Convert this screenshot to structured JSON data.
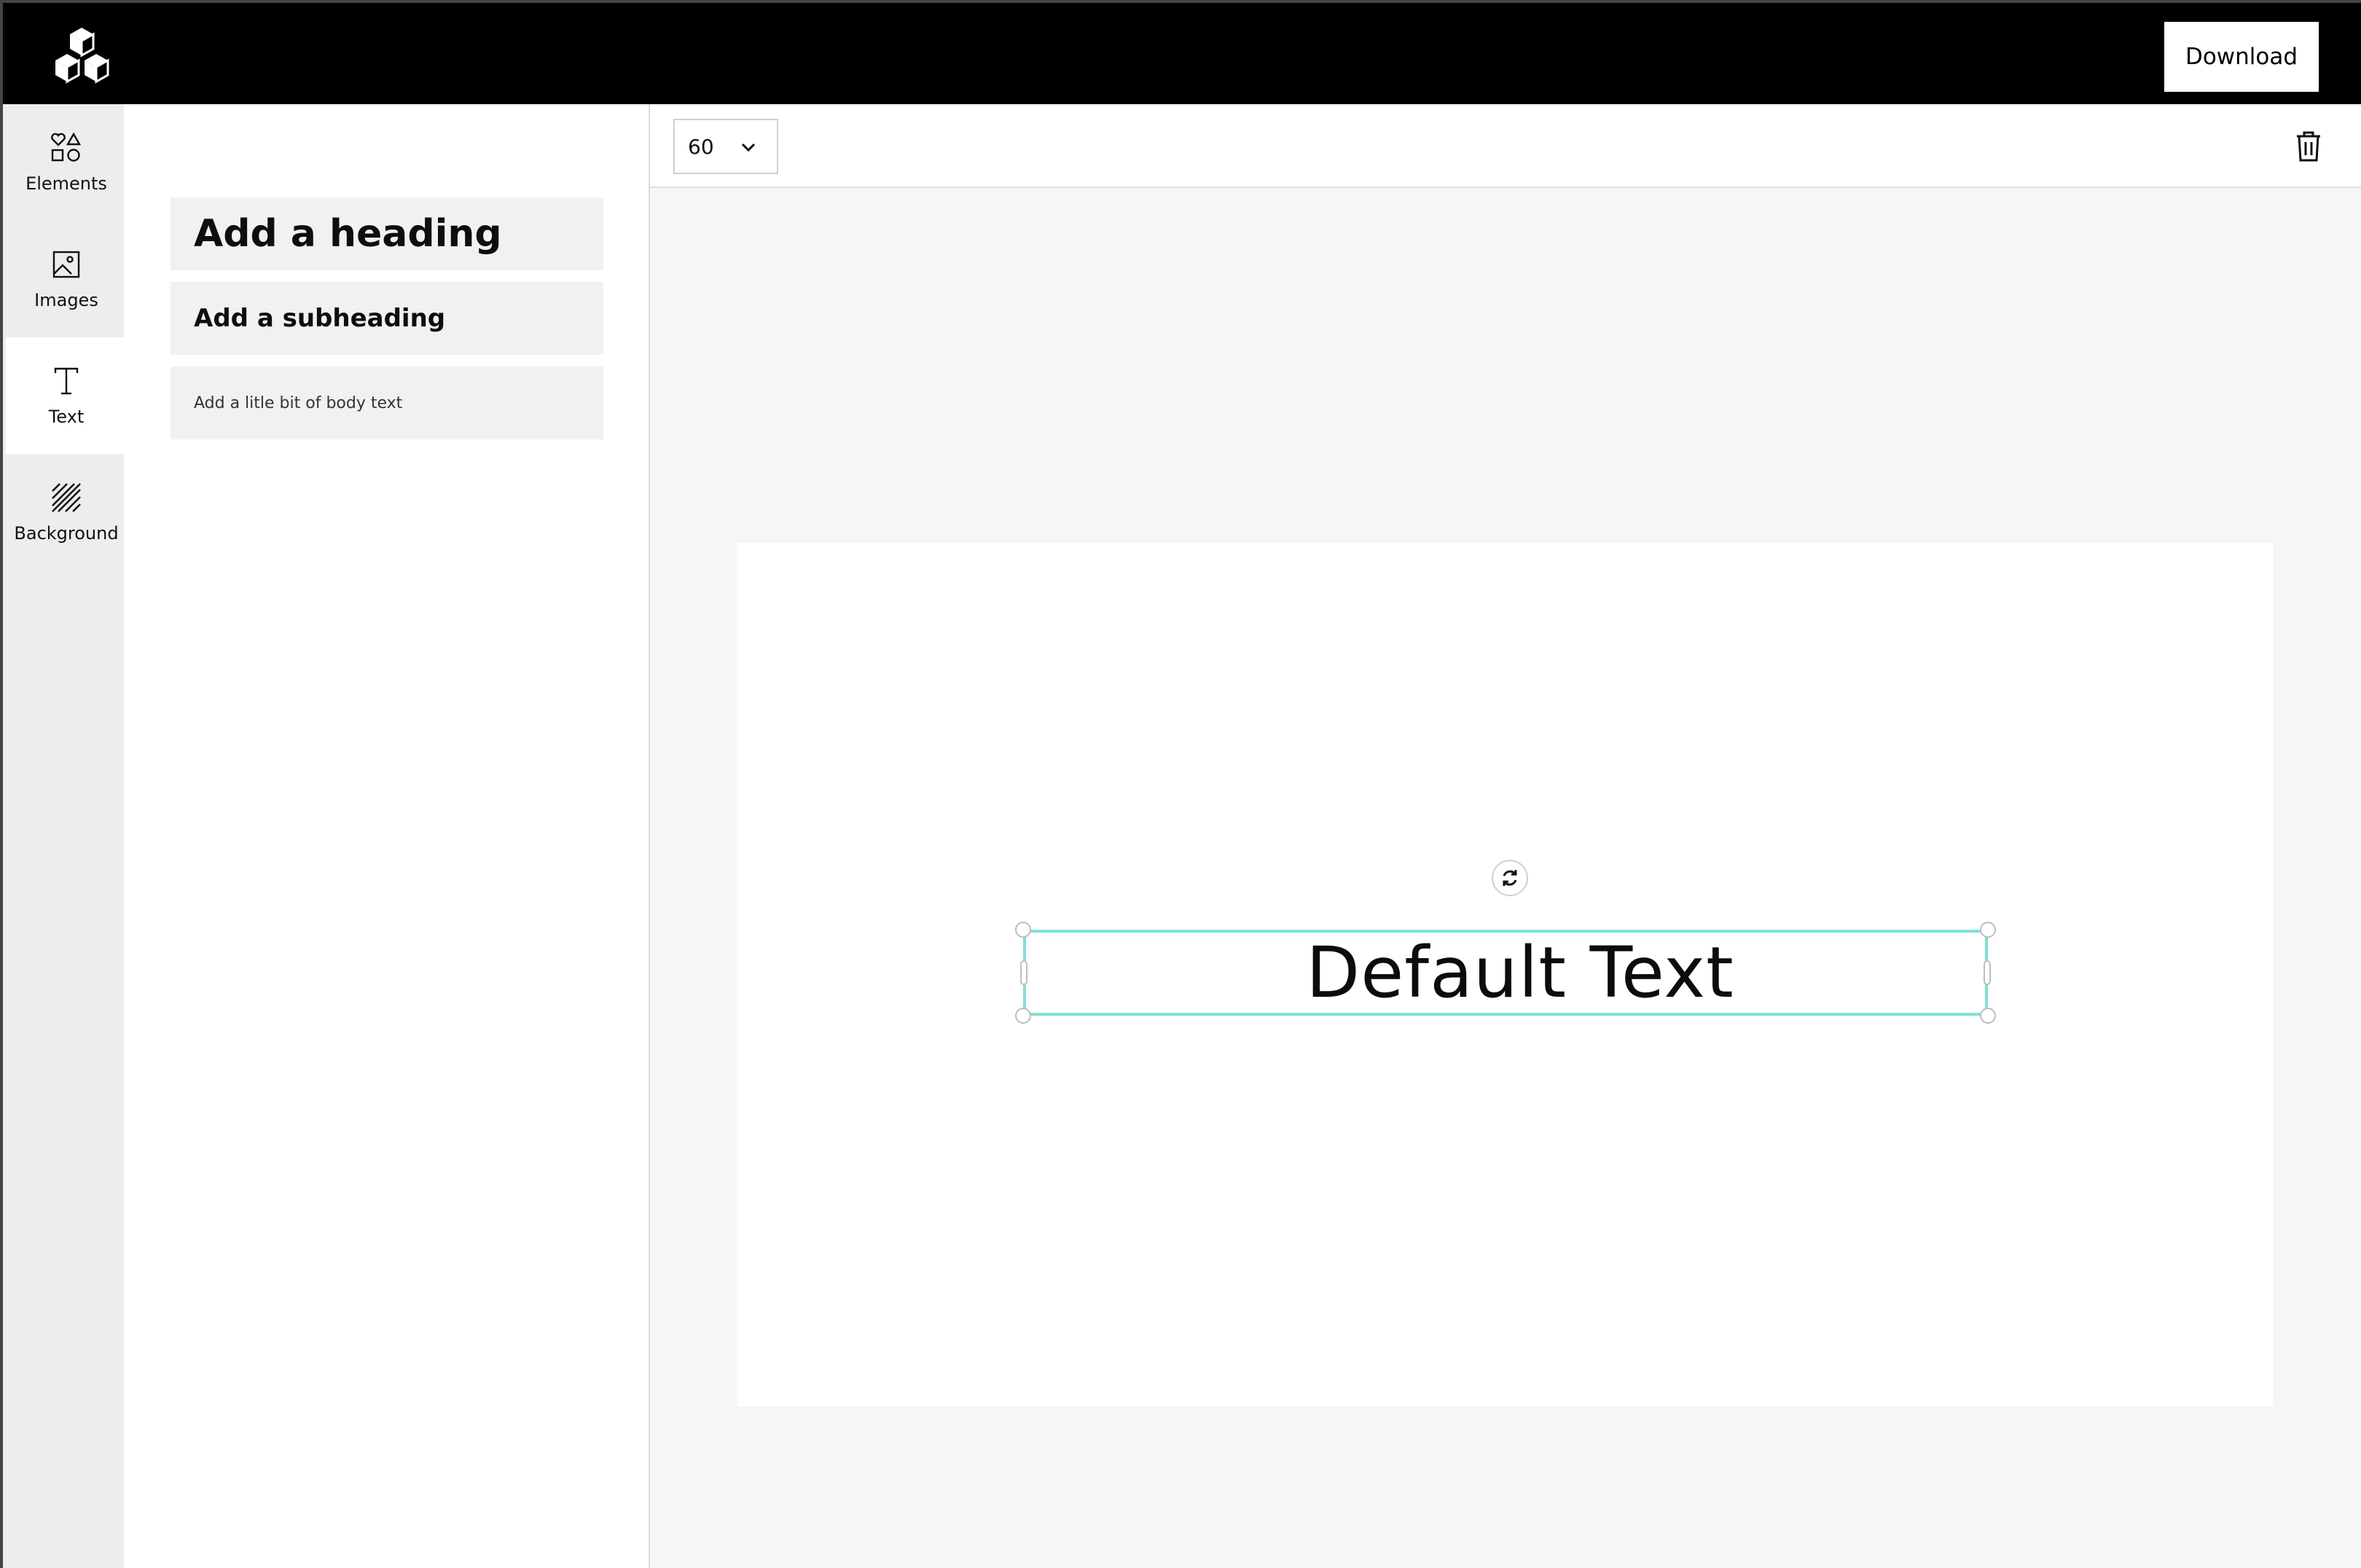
{
  "header": {
    "download_label": "Download",
    "logo_icon": "cubes-logo-icon"
  },
  "sidebar": {
    "items": [
      {
        "label": "Elements",
        "icon": "shapes-icon",
        "active": false
      },
      {
        "label": "Images",
        "icon": "image-icon",
        "active": false
      },
      {
        "label": "Text",
        "icon": "text-icon",
        "active": true
      },
      {
        "label": "Background",
        "icon": "background-icon",
        "active": false
      }
    ]
  },
  "text_panel": {
    "heading_label": "Add a heading",
    "subheading_label": "Add a subheading",
    "body_label": "Add a litle bit of body text"
  },
  "toolbar": {
    "font_size": "60",
    "delete_icon": "trash-icon"
  },
  "canvas": {
    "selected_text": "Default Text",
    "selection_color": "#7fe0d6"
  }
}
